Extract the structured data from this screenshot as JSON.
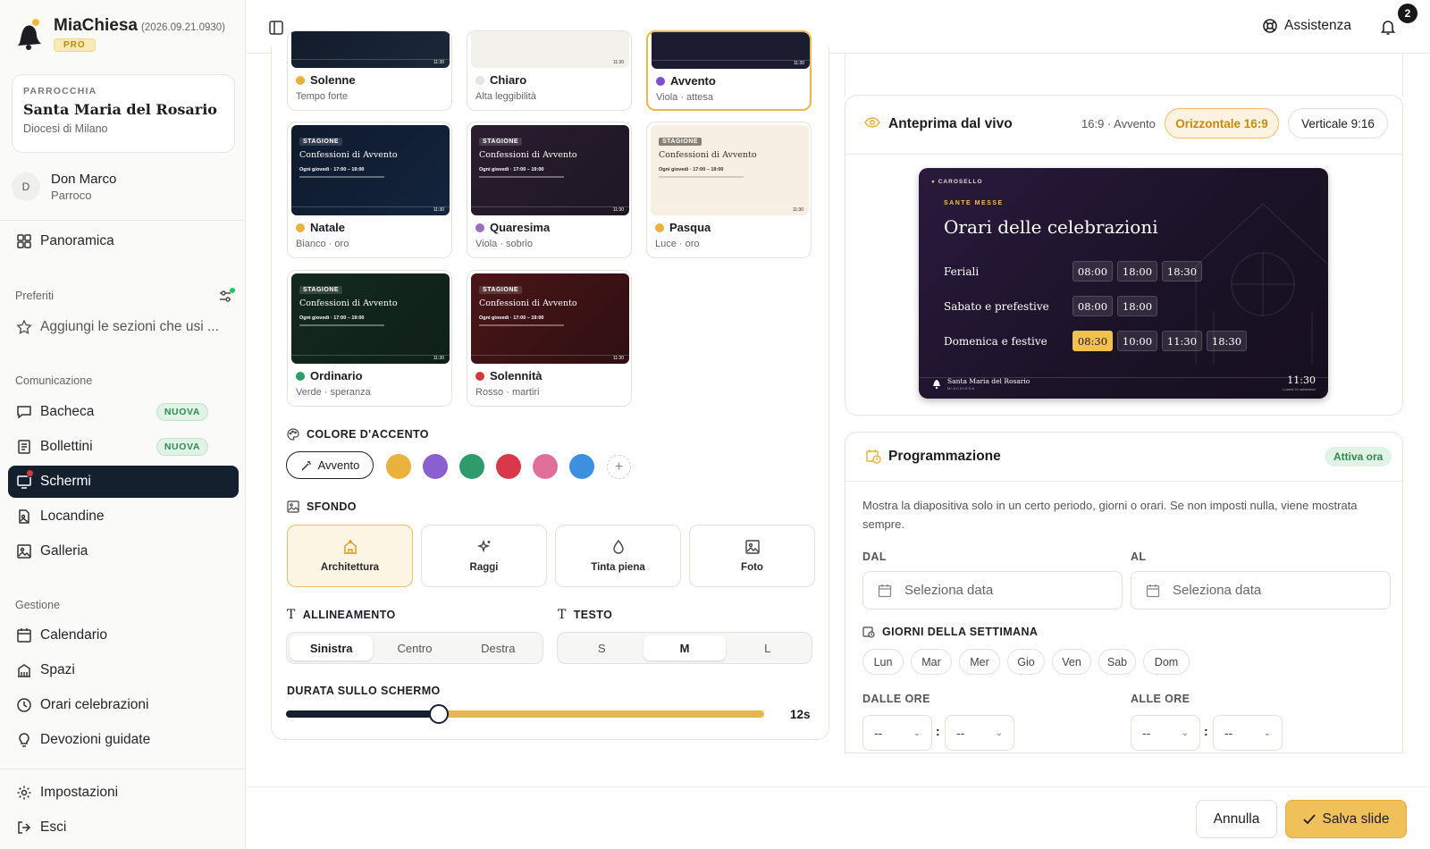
{
  "brand": {
    "name": "MiaChiesa",
    "version": "(2026.09.21.0930)",
    "tier": "PRO"
  },
  "parish": {
    "kicker": "PARROCCHIA",
    "name": "Santa Maria del Rosario",
    "diocese": "Diocesi di Milano"
  },
  "user": {
    "initial": "D",
    "name": "Don Marco",
    "role": "Parroco"
  },
  "nav": {
    "overview": "Panoramica",
    "favorites_title": "Preferiti",
    "favorites_add": "Aggiungi le sezioni che usi ...",
    "comm_title": "Comunicazione",
    "comm": [
      {
        "label": "Bacheca",
        "badge": "NUOVA"
      },
      {
        "label": "Bollettini",
        "badge": "NUOVA"
      },
      {
        "label": "Schermi"
      },
      {
        "label": "Locandine"
      },
      {
        "label": "Galleria"
      }
    ],
    "mgmt_title": "Gestione",
    "mgmt": [
      "Calendario",
      "Spazi",
      "Orari celebrazioni",
      "Devozioni guidate"
    ],
    "settings": "Impostazioni",
    "logout": "Esci"
  },
  "topbar": {
    "help": "Assistenza",
    "notifications": "2"
  },
  "themes": [
    {
      "name": "Solenne",
      "sub": "Tempo forte",
      "color": "#e8b23c"
    },
    {
      "name": "Chiaro",
      "sub": "Alta leggibilità",
      "color": "#e8e6e1"
    },
    {
      "name": "Avvento",
      "sub": "Viola · attesa",
      "color": "#7b4fd0"
    },
    {
      "name": "Natale",
      "sub": "Bianco · oro",
      "color": "#e8b23c"
    },
    {
      "name": "Quaresima",
      "sub": "Viola · sobrio",
      "color": "#9b6fc0"
    },
    {
      "name": "Pasqua",
      "sub": "Luce · oro",
      "color": "#e8b23c"
    },
    {
      "name": "Ordinario",
      "sub": "Verde · speranza",
      "color": "#2f9a6a"
    },
    {
      "name": "Solennità",
      "sub": "Rosso · martiri",
      "color": "#d03a3a"
    }
  ],
  "thumb": {
    "tag": "STAGIONE",
    "title": "Confessioni di Avvento",
    "line": "Ogni giovedì · 17:00 – 19:00",
    "time": "11:30"
  },
  "accent": {
    "label": "COLORE D'ACCENTO",
    "selected": "Avvento",
    "swatches": [
      "#e8b23c",
      "#8b5fd0",
      "#2f9a6a",
      "#d9384a",
      "#e0709a",
      "#3d8fe0"
    ]
  },
  "background": {
    "label": "SFONDO",
    "options": [
      "Architettura",
      "Raggi",
      "Tinta piena",
      "Foto"
    ]
  },
  "alignment": {
    "label": "ALLINEAMENTO",
    "options": [
      "Sinistra",
      "Centro",
      "Destra"
    ]
  },
  "text": {
    "label": "TESTO",
    "options": [
      "S",
      "M",
      "L"
    ]
  },
  "duration": {
    "label": "DURATA SULLO SCHERMO",
    "value": "12s",
    "fraction": 0.32
  },
  "preview": {
    "title": "Anteprima dal vivo",
    "meta": "16:9 · Avvento",
    "horizontal": "Orizzontale 16:9",
    "vertical": "Verticale 9:16",
    "screen": {
      "kicker": "CAROSELLO",
      "section": "SANTE MESSE",
      "title": "Orari delle celebrazioni",
      "rows": [
        {
          "label": "Feriali",
          "times": [
            "08:00",
            "18:00",
            "18:30"
          ]
        },
        {
          "label": "Sabato e prefestive",
          "times": [
            "08:00",
            "18:00"
          ]
        },
        {
          "label": "Domenica e festive",
          "times": [
            "08:30",
            "10:00",
            "11:30",
            "18:30"
          ]
        }
      ],
      "footer": "Santa Maria del Rosario",
      "footer_sub": "MIACHIESA",
      "clock": "11:30",
      "date": "Lunedì 21 settembre"
    }
  },
  "schedule": {
    "title": "Programmazione",
    "status": "Attiva ora",
    "desc": "Mostra la diapositiva solo in un certo periodo, giorni o orari. Se non imposti nulla, viene mostrata sempre.",
    "from_label": "DAL",
    "to_label": "AL",
    "date_placeholder": "Seleziona data",
    "days_label": "GIORNI DELLA SETTIMANA",
    "days": [
      "Lun",
      "Mar",
      "Mer",
      "Gio",
      "Ven",
      "Sab",
      "Dom"
    ],
    "from_hours": "DALLE ORE",
    "to_hours": "ALLE ORE",
    "empty": "--"
  },
  "footer": {
    "cancel": "Annulla",
    "save": "Salva slide"
  }
}
